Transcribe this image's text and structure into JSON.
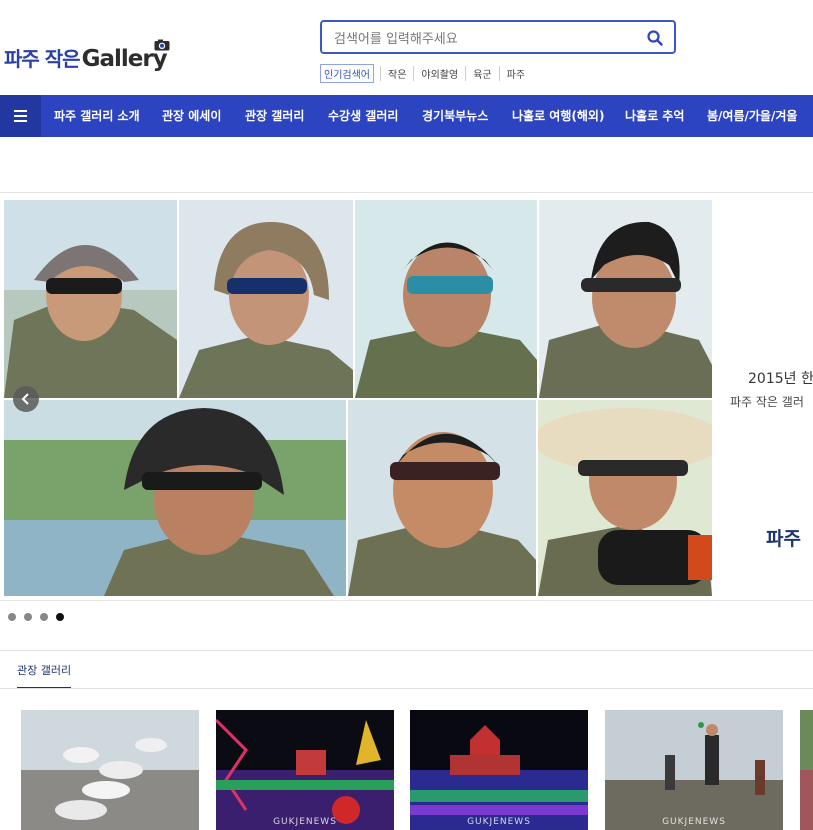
{
  "header": {
    "logo_ko": "파주 작은",
    "logo_en": "Gallery",
    "search": {
      "placeholder": "검색어를 입력해주세요",
      "value": ""
    },
    "popular": {
      "label": "인기검색어",
      "items": [
        "작은",
        "야외촬영",
        "육군",
        "파주"
      ]
    }
  },
  "nav": {
    "items": [
      "파주 갤러리 소개",
      "관장 에세이",
      "관장 갤러리",
      "수강생 갤러리",
      "경기북부뉴스",
      "나홀로 여행(해외)",
      "나홀로 추억",
      "봄/여름/가을/겨울"
    ],
    "accent_color": "#2c44bf"
  },
  "slider": {
    "caption_year": "2015년 한",
    "caption_sub": "파주 작은 갤러",
    "caption_title": "파주",
    "dot_count": 4,
    "active_dot": 4
  },
  "gallery": {
    "tab_label": "관장 갤러리",
    "watermark": "GUKJENEWS"
  }
}
